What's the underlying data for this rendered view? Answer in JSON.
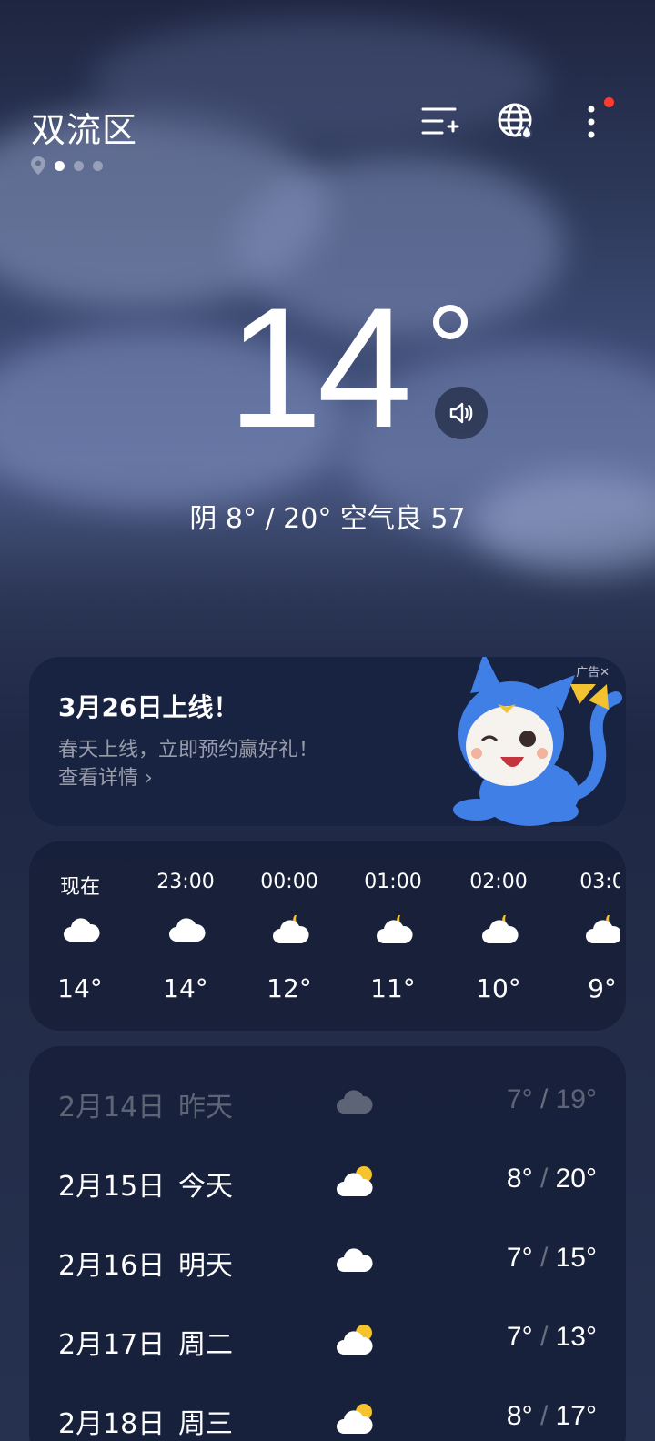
{
  "header": {
    "city": "双流区"
  },
  "current": {
    "temp": "14",
    "summary": "阴  8° / 20°  空气良 57"
  },
  "ad": {
    "title": "3月26日上线！",
    "subtitle": "春天上线，立即预约赢好礼！",
    "link": "查看详情 ›",
    "tag": "广告✕"
  },
  "hourly": [
    {
      "time": "现在",
      "temp": "14°",
      "icon": "cloud-icon"
    },
    {
      "time": "23:00",
      "temp": "14°",
      "icon": "cloud-icon"
    },
    {
      "time": "00:00",
      "temp": "12°",
      "icon": "cloud-moon-icon"
    },
    {
      "time": "01:00",
      "temp": "11°",
      "icon": "cloud-moon-icon"
    },
    {
      "time": "02:00",
      "temp": "10°",
      "icon": "cloud-moon-icon"
    },
    {
      "time": "03:0",
      "temp": "9°",
      "icon": "cloud-moon-icon"
    }
  ],
  "daily": [
    {
      "date": "2月14日",
      "weekday": "昨天",
      "low": "7°",
      "high": "19°",
      "icon": "cloud-icon"
    },
    {
      "date": "2月15日",
      "weekday": "今天",
      "low": "8°",
      "high": "20°",
      "icon": "cloud-sun-icon"
    },
    {
      "date": "2月16日",
      "weekday": "明天",
      "low": "7°",
      "high": "15°",
      "icon": "cloud-icon"
    },
    {
      "date": "2月17日",
      "weekday": "周二",
      "low": "7°",
      "high": "13°",
      "icon": "cloud-sun-icon"
    },
    {
      "date": "2月18日",
      "weekday": "周三",
      "low": "8°",
      "high": "17°",
      "icon": "cloud-sun-icon"
    }
  ]
}
